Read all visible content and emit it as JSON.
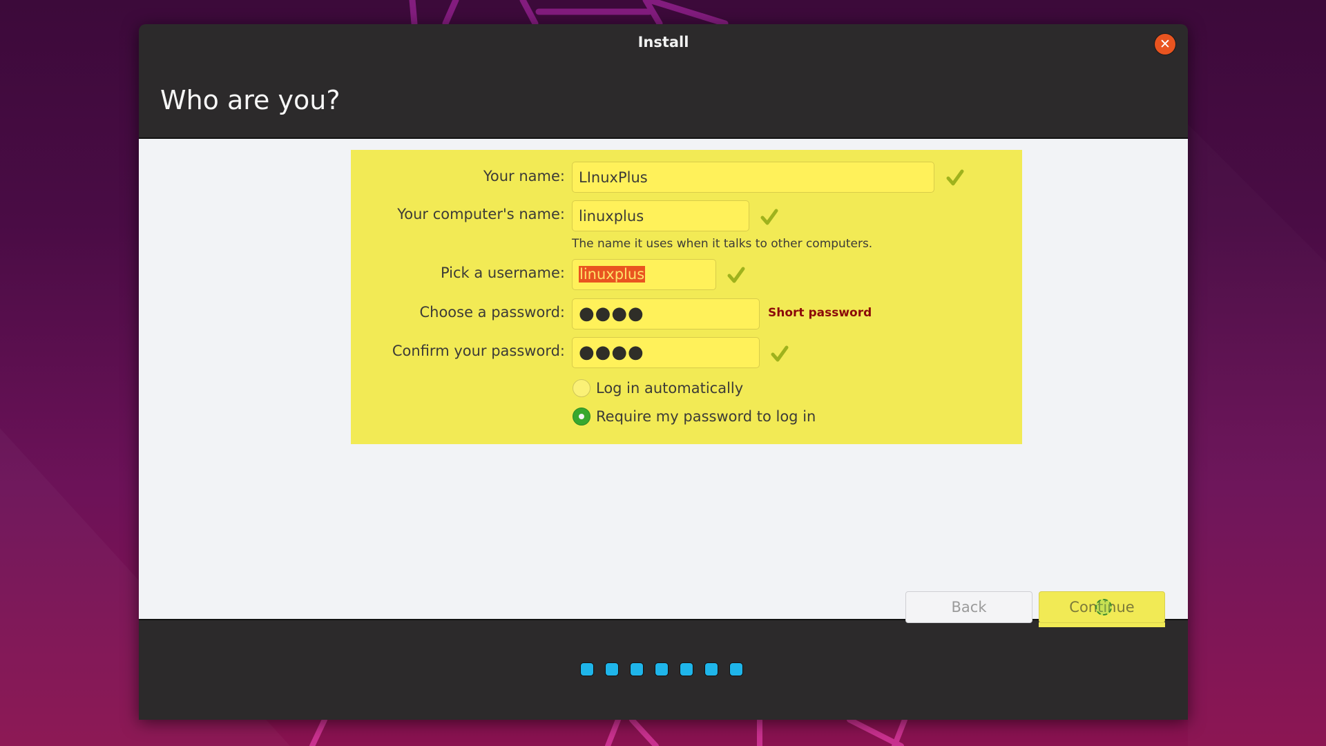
{
  "window": {
    "title": "Install",
    "close_icon": "close-icon",
    "accent_color": "#e95420"
  },
  "page": {
    "title": "Who are you?"
  },
  "form": {
    "highlight_color": "#f2ea55",
    "your_name": {
      "label": "Your name:",
      "value": "LInuxPlus",
      "valid": true
    },
    "computer_name": {
      "label": "Your computer's name:",
      "value": "linuxplus",
      "valid": true,
      "hint": "The name it uses when it talks to other computers."
    },
    "username": {
      "label": "Pick a username:",
      "value": "linuxplus",
      "selected": true,
      "valid": true
    },
    "password": {
      "label": "Choose a password:",
      "masked_value": "●●●●",
      "length": 4,
      "strength_message": "Short password"
    },
    "confirm_password": {
      "label": "Confirm your password:",
      "masked_value": "●●●●",
      "length": 4,
      "valid": true
    },
    "login_options": [
      {
        "label": "Log in automatically",
        "selected": false
      },
      {
        "label": "Require my password to log in",
        "selected": true
      }
    ]
  },
  "buttons": {
    "back_label": "Back",
    "continue_label": "Continue"
  },
  "progress": {
    "total_steps": 7,
    "dot_color": "#1fb5ea"
  }
}
